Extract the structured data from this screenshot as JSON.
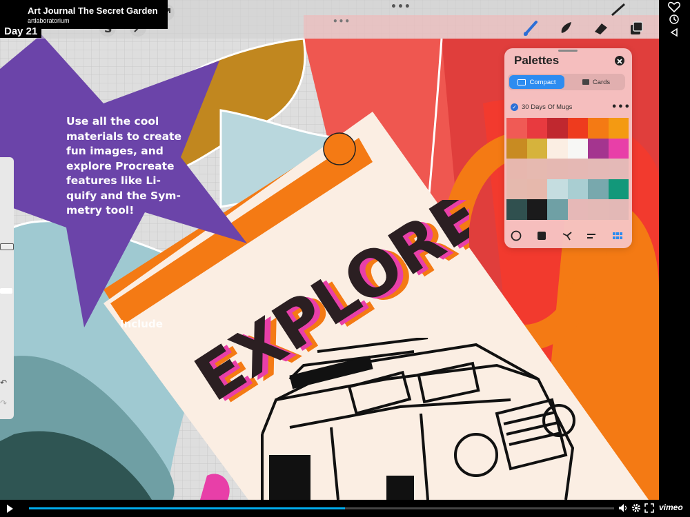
{
  "video": {
    "title": "Art Journal The Secret Garden",
    "channel": "artlaboratorium",
    "day_label": "Day 21",
    "progress": 0.54
  },
  "overlay": {
    "star_text": "Use all the cool materials to create fun images, and explore Procreate features like Li-quify and the Sym-metry tool!",
    "include_text": "Include",
    "card_title": "EXPLORE"
  },
  "palettes": {
    "title": "Palettes",
    "tab_compact": "Compact",
    "tab_cards": "Cards",
    "palette_name": "30 Days Of Mugs",
    "swatches": [
      "#f05a55",
      "#e83a3f",
      "#c0282f",
      "#ee3b1e",
      "#f47a14",
      "#f49a12",
      "#c88b22",
      "#d6b33c",
      "#fbeee3",
      "#f7f7f5",
      "#a4358f",
      "#e83fa8",
      "#e7b7ae",
      "#e6b9b0",
      "#e5b8b2",
      "#e5b8b4",
      "#e4b9b6",
      "#e4b9b7",
      "#e5b9ae",
      "#e6b8ac",
      "#c5dde0",
      "#a9ced2",
      "#78a8ad",
      "#12987a",
      "#30504f",
      "#1a1a1b",
      "#6fa0a5",
      "#e6b8b7",
      "#e4b9b6",
      "#e3b8b6"
    ]
  },
  "player": {
    "brand": "vimeo"
  },
  "colors": {
    "star": "#6b44a9",
    "accent_blue": "#2d8cf0",
    "orange": "#f47a14"
  }
}
